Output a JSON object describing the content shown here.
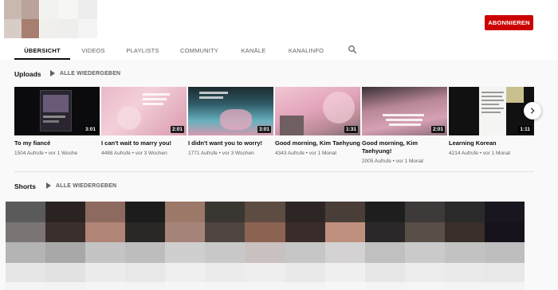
{
  "channel": {
    "subscribe_label": "ABONNIEREN",
    "tabs": [
      "ÜBERSICHT",
      "VIDEOS",
      "PLAYLISTS",
      "COMMUNITY",
      "KANÄLE",
      "KANALINFO"
    ],
    "active_tab": "ÜBERSICHT"
  },
  "uploads": {
    "title": "Uploads",
    "play_all": "ALLE WIEDERGEBEN",
    "videos": [
      {
        "title": "To my fiancé",
        "views": "1504 Aufrufe",
        "age": "vor 1 Woche",
        "duration": "3:01"
      },
      {
        "title": "I can't wait to marry you!",
        "views": "4488 Aufrufe",
        "age": "vor 3 Wochen",
        "duration": "2:01"
      },
      {
        "title": "I didn't want you to worry!",
        "views": "1771 Aufrufe",
        "age": "vor 3 Wochen",
        "duration": "3:01"
      },
      {
        "title": "Good morning, Kim Taehyung",
        "views": "4343 Aufrufe",
        "age": "vor 1 Monat",
        "duration": "1:31"
      },
      {
        "title": "Good morning, Kim Taehyung!",
        "views": "2005 Aufrufe",
        "age": "vor 1 Monat",
        "duration": "2:01"
      },
      {
        "title": "Learning Korean",
        "views": "4214 Aufrufe",
        "age": "vor 1 Monat",
        "duration": "1:11"
      }
    ]
  },
  "shorts": {
    "title": "Shorts",
    "play_all": "ALLE WIEDERGEBEN"
  },
  "icons": {
    "search": "search-icon",
    "play": "play-icon",
    "next": "chevron-right-icon"
  },
  "colors": {
    "subscribe_bg": "#cc0000",
    "page_bg": "#f9f9f9"
  }
}
